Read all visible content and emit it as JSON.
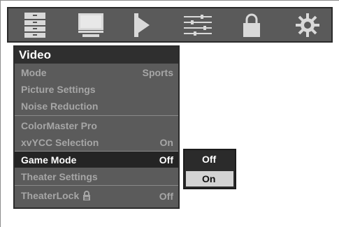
{
  "icons": [
    {
      "name": "picture-list-icon"
    },
    {
      "name": "monitor-icon"
    },
    {
      "name": "speaker-icon"
    },
    {
      "name": "settings-sliders-icon"
    },
    {
      "name": "lock-icon"
    },
    {
      "name": "gear-icon"
    }
  ],
  "menu": {
    "title": "Video",
    "items": [
      {
        "label": "Mode",
        "value": "Sports"
      },
      {
        "label": "Picture Settings",
        "value": ""
      },
      {
        "label": "Noise Reduction",
        "value": ""
      },
      {
        "label": "ColorMaster Pro",
        "value": ""
      },
      {
        "label": "xvYCC Selection",
        "value": "On"
      },
      {
        "label": "Game Mode",
        "value": "Off",
        "selected": true
      },
      {
        "label": "Theater Settings",
        "value": ""
      },
      {
        "label": "TheaterLock",
        "value": "Off",
        "icon": "lock-icon"
      }
    ]
  },
  "submenu": {
    "options": [
      {
        "label": "Off"
      },
      {
        "label": "On",
        "selected": true
      }
    ]
  },
  "colors": {
    "bar": "#5a5a5a",
    "menu_bg": "#5b5b5b",
    "title_bg": "#2f2f2f",
    "selected_row": "#242424",
    "selected_option": "#d3d3d3",
    "dim_text": "#a6a6a6"
  }
}
